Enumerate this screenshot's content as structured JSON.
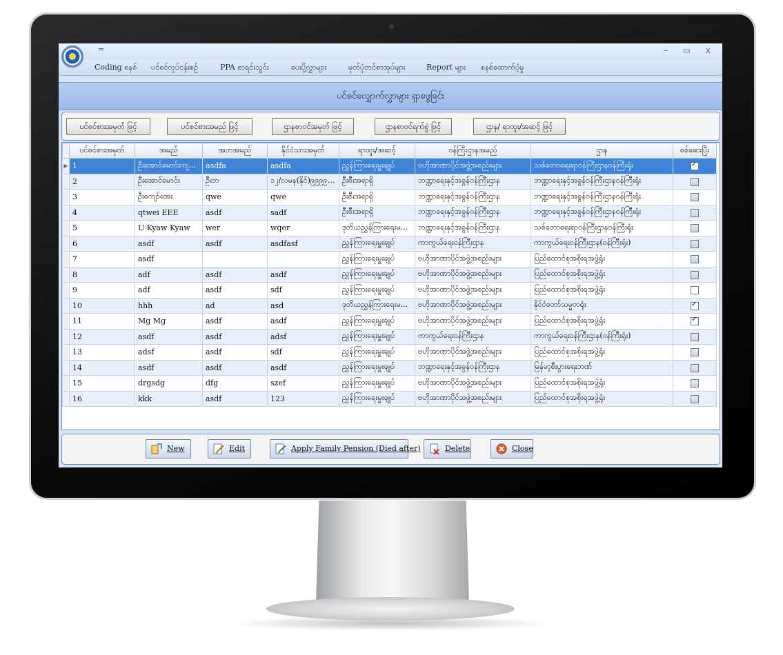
{
  "window": {
    "qat_label": "=",
    "minimize": "–",
    "restore": "▭",
    "close": "x"
  },
  "menu": [
    "Coding စနစ်",
    "ပင်စင်လုပ်ငန်းစဉ်",
    "PPA စာရင်းသွင်း",
    "ပေးပို့လွှာများ",
    "မှတ်ပုံတင်စာအုပ်များ",
    "Report များ",
    "စနစ်ထောက်ပံ့မှု"
  ],
  "form_title": "ပင်စင်လျှောက်လွှာများ ရှာဖွေခြင်း",
  "search_buttons": [
    "ပင်စင်စားအမှတ် ဖြင့်",
    "ပင်စင်စားအမည် ဖြင့်",
    "ဌာနစာဝင်အမှတ် ဖြင့်",
    "ဌာနစာဝင်ရက်စွဲ ဖြင့်",
    "ဌာန/ ရာထူး/အဆင့် ဖြင့်"
  ],
  "columns": [
    "ပင်စင်စားအမှတ်",
    "အမည်",
    "အဘအမည်",
    "နိုင်ငံသားအမှတ်",
    "ရာထူး/အဆင့်",
    "ဝန်ကြီးဌာနအမည်",
    "ဌာန",
    "စစ်ဆေးပြီး"
  ],
  "rows": [
    {
      "no": "1",
      "name": "ဦးအောင်မောင်းကျ...",
      "father": "asdfa",
      "nrc": "asdfa",
      "rank": "ညွှန်ကြားရေးမှူးချုပ်",
      "ministry": "ဗဟိုအာဏာပိုင်အဖွဲ့အစည်းများ",
      "dept": "သစ်တောရေးရာဝန်ကြီးဌာနဝန်ကြီးရုံး",
      "checked": true
    },
    {
      "no": "2",
      "name": "ဦးအောင်မောင်း",
      "father": "ဦးဘ",
      "nrc": "၁၂/လမန(နိုင်)၉၉၉၉၉...",
      "rank": "ဦးစီးအရာရှိ",
      "ministry": "ဘဏ္ဍာရေးနှင့်အခွန်ဝန်ကြီးဌာန",
      "dept": "ဘဏ္ဍာရေးနှင့်အခွန်ဝန်ကြီးဌာနဝန်ကြီးရုံး",
      "checked": false
    },
    {
      "no": "3",
      "name": "ဦးကျော်အေး",
      "father": "qwe",
      "nrc": "qwe",
      "rank": "ဦးစီးအရာရှိ",
      "ministry": "ဘဏ္ဍာရေးနှင့်အခွန်ဝန်ကြီးဌာန",
      "dept": "ဘဏ္ဍာရေးနှင့်အခွန်ဝန်ကြီးဌာနဝန်ကြီးရုံး",
      "checked": false
    },
    {
      "no": "4",
      "name": "qtwei EEE",
      "father": "asdf",
      "nrc": "sadf",
      "rank": "ဦးစီးအရာရှိ",
      "ministry": "ဘဏ္ဍာရေးနှင့်အခွန်ဝန်ကြီးဌာန",
      "dept": "ဘဏ္ဍာရေးနှင့်အခွန်ဝန်ကြီးဌာနဝန်ကြီးရုံး",
      "checked": false
    },
    {
      "no": "5",
      "name": "U Kyaw Kyaw",
      "father": "wer",
      "nrc": "wqer",
      "rank": "ဒုတိယညွှန်ကြားရေးမ...",
      "ministry": "ဘဏ္ဍာရေးနှင့်အခွန်ဝန်ကြီးဌာန",
      "dept": "သစ်တောရေးရာဝန်ကြီးဌာနဝန်ကြီးရုံး",
      "checked": false
    },
    {
      "no": "6",
      "name": "asdf",
      "father": "asdf",
      "nrc": "asdfasf",
      "rank": "ညွှန်ကြားရေးမှူးချုပ်",
      "ministry": "ကာကွယ်ရေးဝန်ကြီးဌာန",
      "dept": "ကာကွယ်ရေးဝန်ကြီးဌာန(ဝန်ကြီးရုံး)",
      "checked": false
    },
    {
      "no": "7",
      "name": "asdf",
      "father": "",
      "nrc": "",
      "rank": "ညွှန်ကြားရေးမှူးချုပ်",
      "ministry": "ဗဟိုအာဏာပိုင်အဖွဲ့အစည်းများ",
      "dept": "ပြည်ထောင်စုအစိုးရအဖွဲ့ရုံး",
      "checked": false
    },
    {
      "no": "8",
      "name": "adf",
      "father": "asdf",
      "nrc": "asdf",
      "rank": "ညွှန်ကြားရေးမှူးချုပ်",
      "ministry": "ဗဟိုအာဏာပိုင်အဖွဲ့အစည်းများ",
      "dept": "ပြည်ထောင်စုအစိုးရအဖွဲ့ရုံး",
      "checked": false
    },
    {
      "no": "9",
      "name": "adf",
      "father": "asdf",
      "nrc": "sdf",
      "rank": "ညွှန်ကြားရေးမှူးချုပ်",
      "ministry": "ဗဟိုအာဏာပိုင်အဖွဲ့အစည်းများ",
      "dept": "ပြည်ထောင်စုအစိုးရအဖွဲ့ရုံး",
      "checked": false
    },
    {
      "no": "10",
      "name": "hhh",
      "father": "ad",
      "nrc": "asd",
      "rank": "ဒုတိယညွှန်ကြားရေးမ...",
      "ministry": "ဗဟိုအာဏာပိုင်အဖွဲ့အစည်းများ",
      "dept": "နိုင်ငံတော်သမ္မတရုံး",
      "checked": true
    },
    {
      "no": "11",
      "name": "Mg Mg",
      "father": "asdf",
      "nrc": "asdf",
      "rank": "ညွှန်ကြားရေးမှူးချုပ်",
      "ministry": "ဗဟိုအာဏာပိုင်အဖွဲ့အစည်းများ",
      "dept": "ပြည်ထောင်စုအစိုးရအဖွဲ့ရုံး",
      "checked": true
    },
    {
      "no": "12",
      "name": "asdf",
      "father": "asdf",
      "nrc": "adsf",
      "rank": "ညွှန်ကြားရေးမှူးချုပ်",
      "ministry": "ကာကွယ်ရေးဝန်ကြီးဌာန",
      "dept": "ကာကွယ်ရေးဝန်ကြီးဌာန(ဝန်ကြီးရုံး)",
      "checked": false
    },
    {
      "no": "13",
      "name": "adsf",
      "father": "asdf",
      "nrc": "sdf",
      "rank": "ညွှန်ကြားရေးမှူးချုပ်",
      "ministry": "ဗဟိုအာဏာပိုင်အဖွဲ့အစည်းများ",
      "dept": "ပြည်ထောင်စုအစိုးရအဖွဲ့ရုံး",
      "checked": false
    },
    {
      "no": "14",
      "name": "asdf",
      "father": "asdf",
      "nrc": "asdf",
      "rank": "ညွှန်ကြားရေးမှူးချုပ်",
      "ministry": "ဘဏ္ဍာရေးနှင့်အခွန်ဝန်ကြီးဌာန",
      "dept": "မြန်မာ့စီးပွားရေးဘဏ်",
      "checked": false
    },
    {
      "no": "15",
      "name": "drgsdg",
      "father": "dfg",
      "nrc": "szef",
      "rank": "ညွှန်ကြားရေးမှူးချုပ်",
      "ministry": "ဗဟိုအာဏာပိုင်အဖွဲ့အစည်းများ",
      "dept": "ပြည်ထောင်စုအစိုးရအဖွဲ့ရုံး",
      "checked": false
    },
    {
      "no": "16",
      "name": "kkk",
      "father": "asdf",
      "nrc": "123",
      "rank": "ညွှန်ကြားရေးမှူးချုပ်",
      "ministry": "ဗဟိုအာဏာပိုင်အဖွဲ့အစည်းများ",
      "dept": "ပြည်ထောင်စုအစိုးရအဖွဲ့ရုံး",
      "checked": false
    }
  ],
  "selected_row": 0,
  "action_buttons": [
    {
      "name": "new-button",
      "label": "New",
      "icon": "new-icon"
    },
    {
      "name": "edit-button",
      "label": "Edit",
      "icon": "edit-icon"
    },
    {
      "name": "apply-family-pension-button",
      "label": "Apply Family Pension (Died after)",
      "icon": "document-pen-icon"
    },
    {
      "name": "delete-button",
      "label": "Delete",
      "icon": "delete-icon"
    },
    {
      "name": "close-button",
      "label": "Close",
      "icon": "close-circle-icon"
    }
  ],
  "colors": {
    "selection": "#3e83d8",
    "header_band": "#9bb9ea",
    "window_bg": "#d6e4f7"
  }
}
